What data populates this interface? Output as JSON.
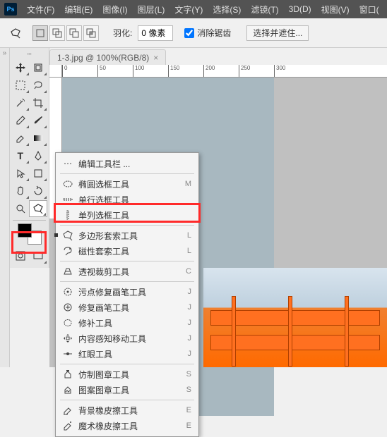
{
  "menubar": {
    "items": [
      "文件(F)",
      "编辑(E)",
      "图像(I)",
      "图层(L)",
      "文字(Y)",
      "选择(S)",
      "滤镜(T)",
      "3D(D)",
      "视图(V)",
      "窗口("
    ]
  },
  "optbar": {
    "feather_label": "羽化:",
    "feather_value": "0 像素",
    "aa_label": "消除锯齿",
    "selectmask": "选择并遮住..."
  },
  "tab": {
    "title": "1-3.jpg @ 100%(RGB/8)",
    "close": "×"
  },
  "ruler": {
    "ticks": [
      "0",
      "50",
      "100",
      "150",
      "200",
      "250",
      "300"
    ]
  },
  "context": {
    "edit": "编辑工具栏 ...",
    "items": [
      {
        "icon": "ellipse",
        "label": "椭圆选框工具",
        "sc": "M",
        "mark": false
      },
      {
        "icon": "row",
        "label": "单行选框工具",
        "sc": "",
        "mark": false
      },
      {
        "icon": "col",
        "label": "单列选框工具",
        "sc": "",
        "mark": false
      },
      {
        "icon": "poly",
        "label": "多边形套索工具",
        "sc": "L",
        "mark": true
      },
      {
        "icon": "mag",
        "label": "磁性套索工具",
        "sc": "L",
        "mark": false
      },
      {
        "icon": "persp",
        "label": "透视裁剪工具",
        "sc": "C",
        "mark": false
      },
      {
        "icon": "spot",
        "label": "污点修复画笔工具",
        "sc": "J",
        "mark": false
      },
      {
        "icon": "heal",
        "label": "修复画笔工具",
        "sc": "J",
        "mark": false
      },
      {
        "icon": "patch",
        "label": "修补工具",
        "sc": "J",
        "mark": false
      },
      {
        "icon": "move",
        "label": "内容感知移动工具",
        "sc": "J",
        "mark": false
      },
      {
        "icon": "eye",
        "label": "红眼工具",
        "sc": "J",
        "mark": false
      },
      {
        "icon": "clone",
        "label": "仿制图章工具",
        "sc": "S",
        "mark": false
      },
      {
        "icon": "pstamp",
        "label": "图案图章工具",
        "sc": "S",
        "mark": false
      },
      {
        "icon": "beraser",
        "label": "背景橡皮擦工具",
        "sc": "E",
        "mark": false
      },
      {
        "icon": "meraser",
        "label": "魔术橡皮擦工具",
        "sc": "E",
        "mark": false
      }
    ]
  }
}
